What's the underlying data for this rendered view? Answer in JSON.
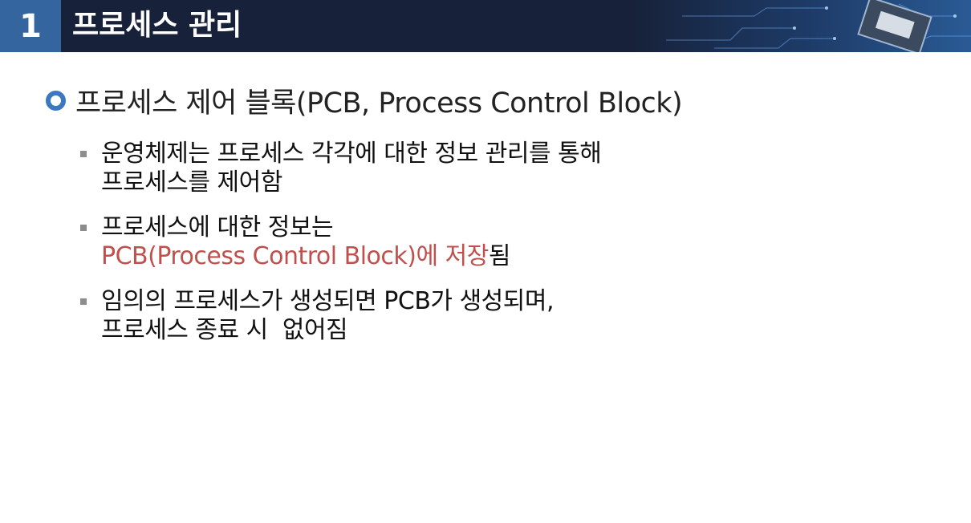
{
  "header": {
    "number": "1",
    "title": "프로세스 관리"
  },
  "heading": {
    "text": "프로세스 제어 블록(PCB, Process Control Block)"
  },
  "bullets": [
    {
      "line1": "운영체제는 프로세스 각각에 대한 정보 관리를 통해",
      "line2": "프로세스를 제어함"
    },
    {
      "line1": "프로세스에 대한 정보는",
      "line2_highlight": "PCB(Process Control Block)에 저장",
      "line2_rest": "됨"
    },
    {
      "line1": "임의의 프로세스가 생성되면 PCB가 생성되며,",
      "line2": "프로세스 종료 시  없어짐"
    }
  ],
  "colors": {
    "header_bg": "#17223a",
    "number_box": "#35659f",
    "ring_bullet": "#3b78c2",
    "highlight": "#c0504d",
    "square_bullet": "#8c8c8c"
  },
  "icons": {
    "heading_bullet": "ring-bullet-icon",
    "item_bullet": "square-bullet-icon",
    "header_decoration": "circuit-chip-icon"
  }
}
